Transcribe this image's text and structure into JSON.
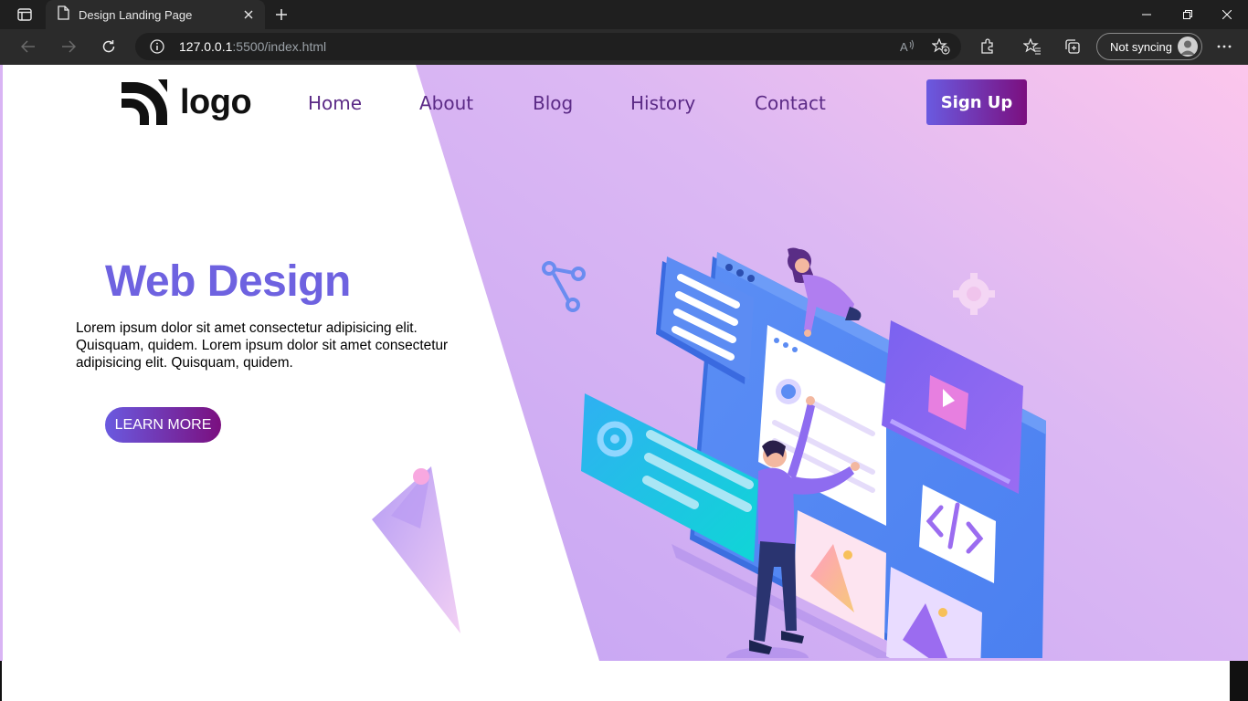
{
  "browser": {
    "tab_title": "Design Landing Page",
    "url_host": "127.0.0.1",
    "url_rest": ":5500/index.html",
    "profile_label": "Not syncing"
  },
  "site": {
    "logo_text": "logo",
    "nav": [
      "Home",
      "About",
      "Blog",
      "History",
      "Contact"
    ],
    "signup_label": "Sign Up"
  },
  "hero": {
    "title": "Web Design",
    "text": "Lorem ipsum dolor sit amet consectetur adipisicing elit. Quisquam, quidem. Lorem ipsum dolor sit amet consectetur adipisicing elit. Quisquam, quidem.",
    "button_label": "LEARN MORE"
  },
  "colors": {
    "accent": "#6e62e0",
    "nav_text": "#5b2a86",
    "button_gradient_start": "#6a5ae0",
    "button_gradient_end": "#7b0f7f",
    "hero_bg_start": "#c9a8f2",
    "hero_bg_end": "#fbc6ec"
  }
}
